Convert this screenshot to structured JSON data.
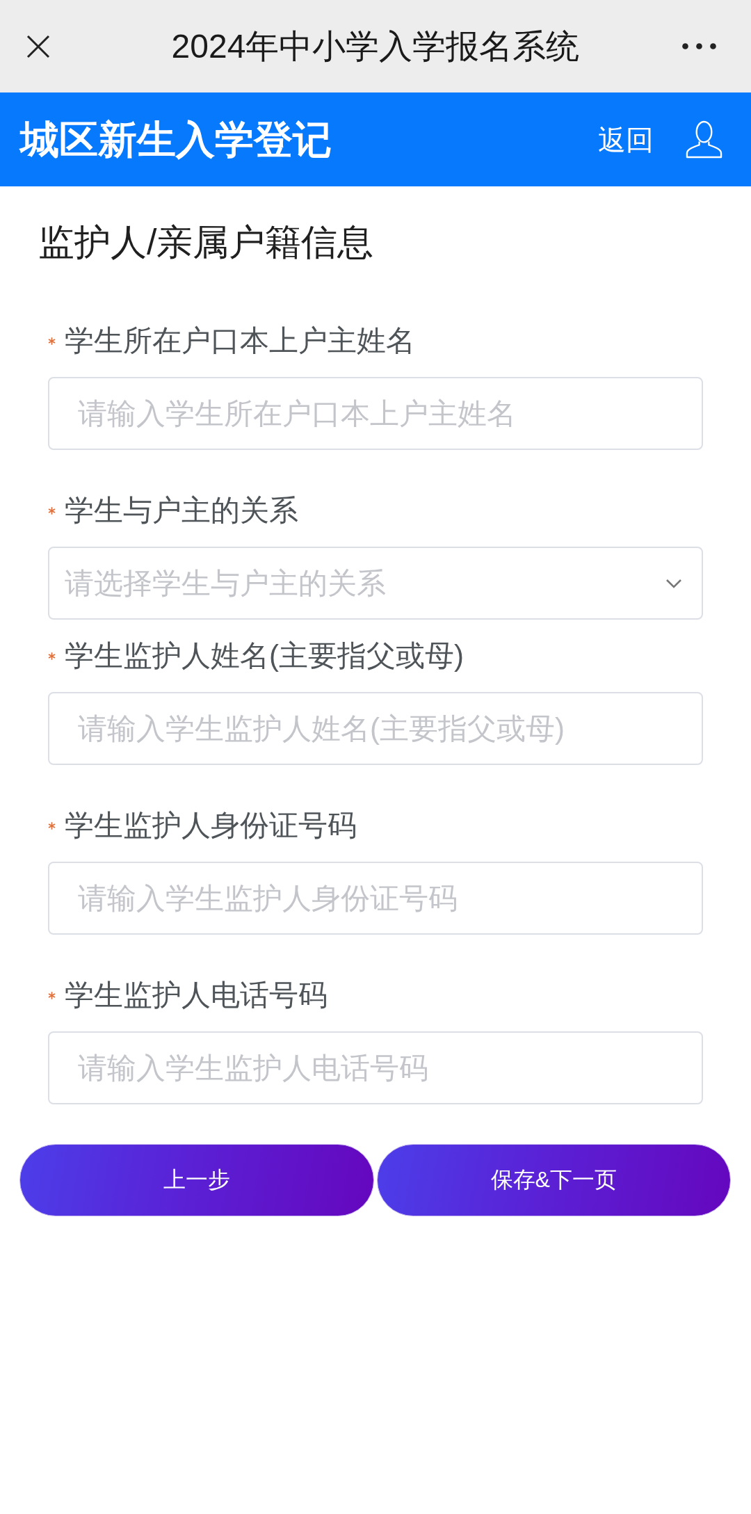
{
  "top_bar": {
    "title": "2024年中小学入学报名系统"
  },
  "header": {
    "title": "城区新生入学登记",
    "back_link": "返回"
  },
  "section": {
    "title": "监护人/亲属户籍信息"
  },
  "fields": [
    {
      "kind": "input",
      "label": "学生所在户口本上户主姓名",
      "required": true,
      "placeholder": "请输入学生所在户口本上户主姓名"
    },
    {
      "kind": "select",
      "label": "学生与户主的关系",
      "required": true,
      "placeholder": "请选择学生与户主的关系"
    },
    {
      "kind": "input",
      "label": "学生监护人姓名(主要指父或母)",
      "required": true,
      "placeholder": "请输入学生监护人姓名(主要指父或母)"
    },
    {
      "kind": "input",
      "label": "学生监护人身份证号码",
      "required": true,
      "placeholder": "请输入学生监护人身份证号码"
    },
    {
      "kind": "input",
      "label": "学生监护人电话号码",
      "required": true,
      "placeholder": "请输入学生监护人电话号码"
    }
  ],
  "buttons": [
    {
      "label": "上一步"
    },
    {
      "label": "保存&下一页"
    }
  ]
}
